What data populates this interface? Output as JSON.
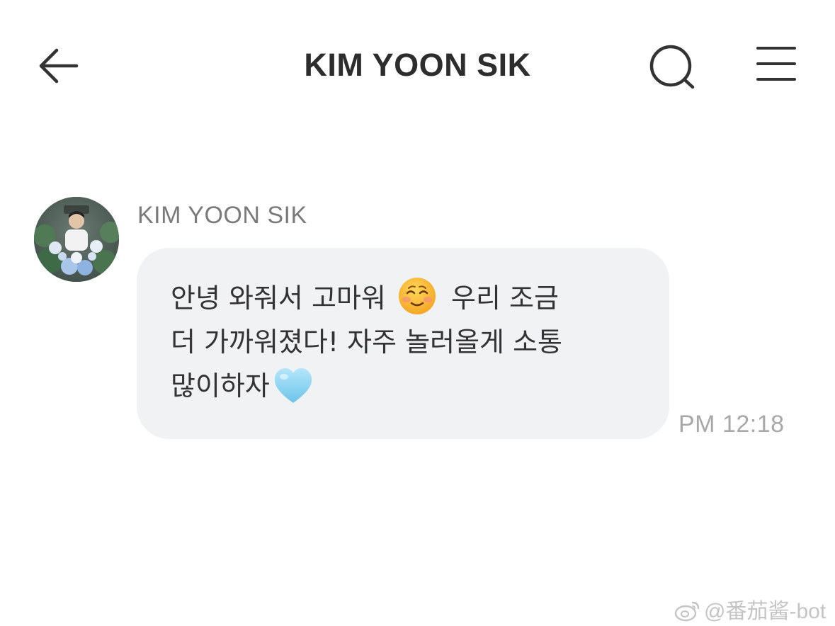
{
  "header": {
    "title": "KIM YOON SIK",
    "back_icon": "arrow-left-icon",
    "search_icon": "search-icon",
    "menu_icon": "hamburger-menu-icon"
  },
  "message": {
    "sender": "KIM YOON SIK",
    "lines": {
      "line1_a": "안녕 와줘서 고마워",
      "line1_emoji": "smiling-face-emoji",
      "line1_b": "우리 조금",
      "line2": "더 가까워졌다! 자주 놀러올게 소통",
      "line3": "많이하자",
      "line3_emoji": "light-blue-heart-emoji"
    },
    "time": "PM 12:18"
  },
  "watermark": {
    "text": "@番茄酱-bot",
    "icon": "weibo-icon"
  },
  "colors": {
    "title": "#2d2d2d",
    "bubble": "#f1f2f3",
    "sender": "#7a7a7a",
    "timestamp": "#a8a8a8",
    "heart": "#8fd3f0"
  }
}
